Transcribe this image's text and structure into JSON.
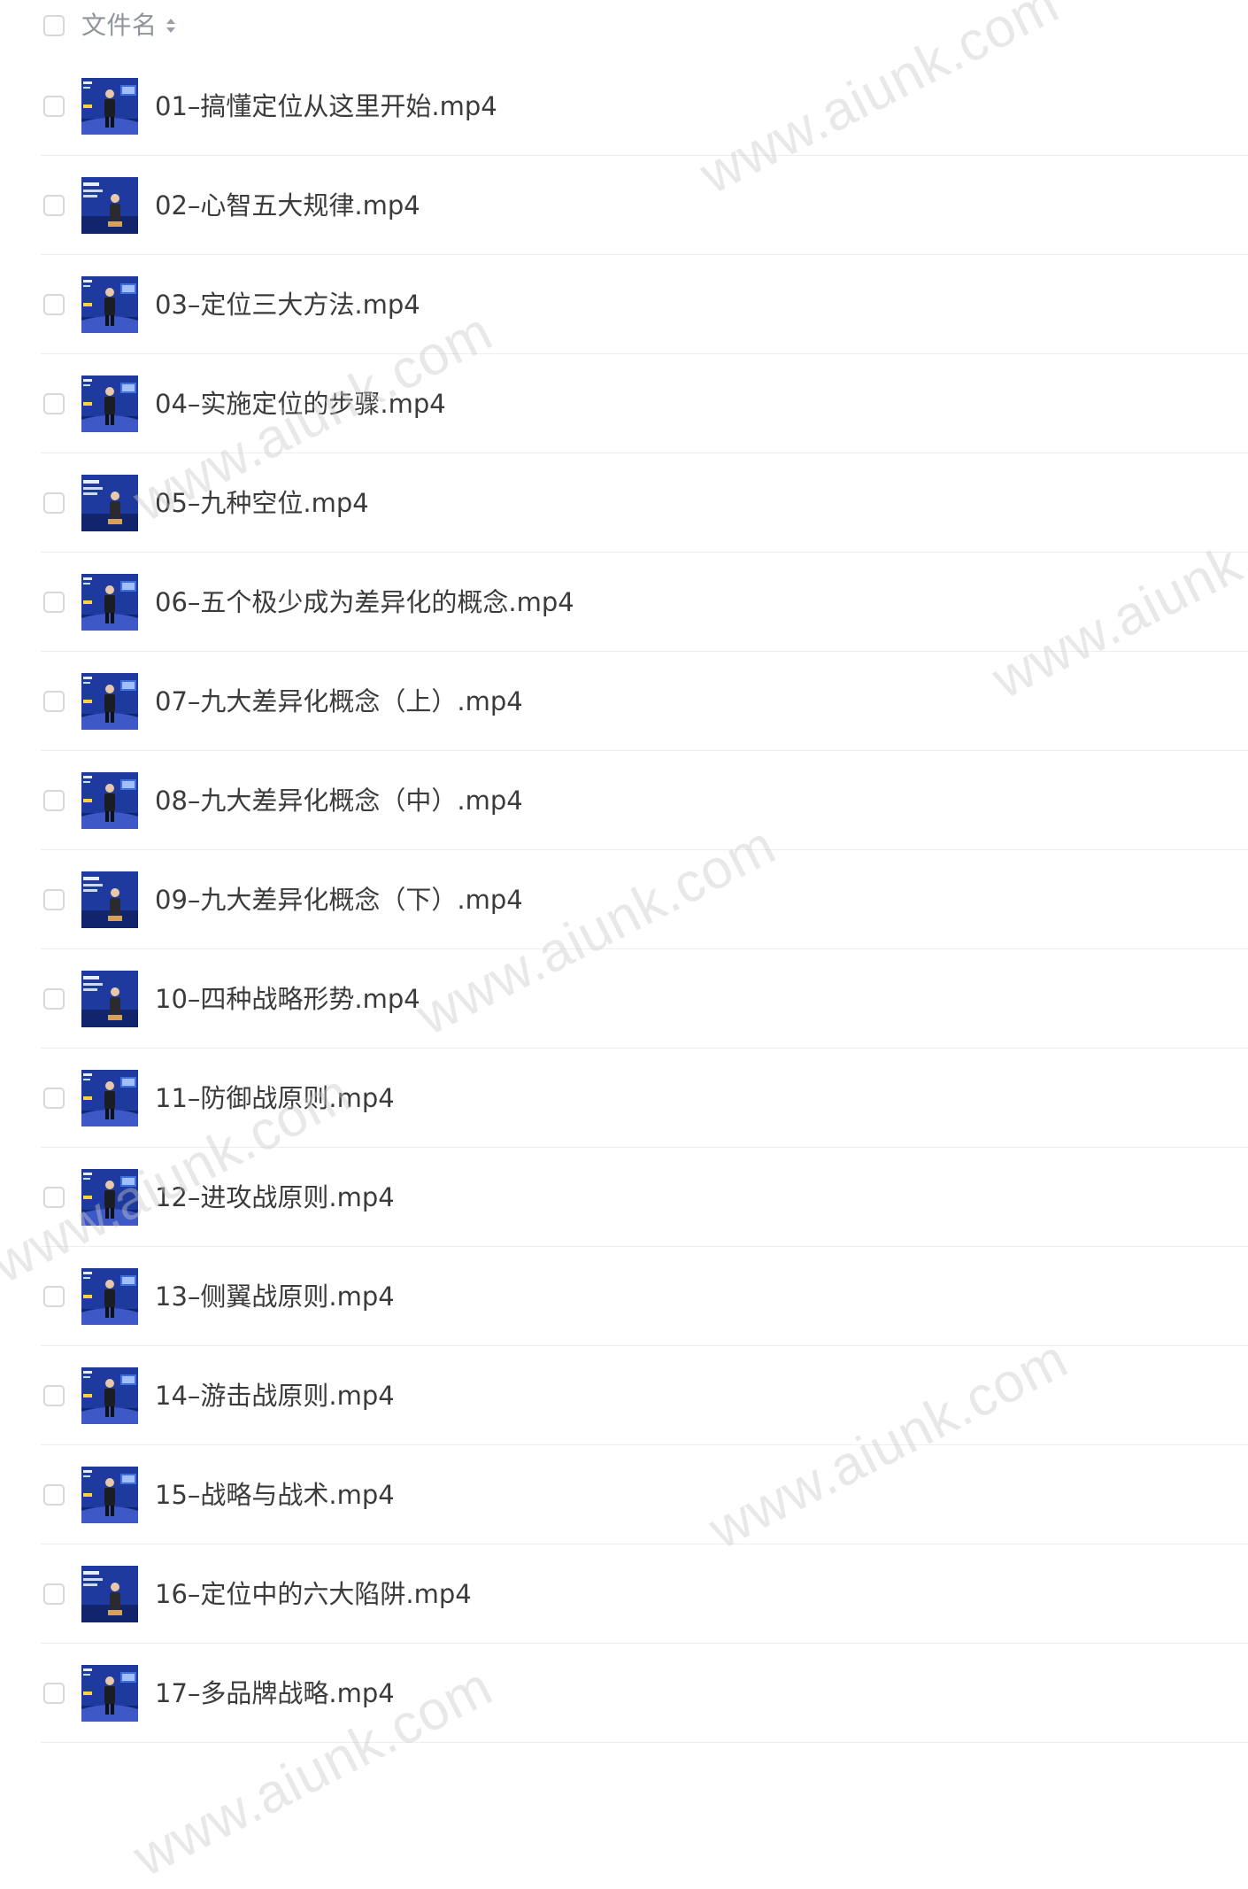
{
  "header": {
    "column_label": "文件名",
    "sort_icon": "sort-updown-icon"
  },
  "files": [
    {
      "name": "01–搞懂定位从这里开始.mp4",
      "thumb": "a"
    },
    {
      "name": "02–心智五大规律.mp4",
      "thumb": "b"
    },
    {
      "name": "03–定位三大方法.mp4",
      "thumb": "a"
    },
    {
      "name": "04–实施定位的步骤.mp4",
      "thumb": "a"
    },
    {
      "name": "05–九种空位.mp4",
      "thumb": "b"
    },
    {
      "name": "06–五个极少成为差异化的概念.mp4",
      "thumb": "a"
    },
    {
      "name": "07–九大差异化概念（上）.mp4",
      "thumb": "a"
    },
    {
      "name": "08–九大差异化概念（中）.mp4",
      "thumb": "a"
    },
    {
      "name": "09–九大差异化概念（下）.mp4",
      "thumb": "b"
    },
    {
      "name": "10–四种战略形势.mp4",
      "thumb": "b"
    },
    {
      "name": "11–防御战原则.mp4",
      "thumb": "a"
    },
    {
      "name": "12–进攻战原则.mp4",
      "thumb": "a"
    },
    {
      "name": "13–侧翼战原则.mp4",
      "thumb": "a"
    },
    {
      "name": "14–游击战原则.mp4",
      "thumb": "a"
    },
    {
      "name": "15–战略与战术.mp4",
      "thumb": "a"
    },
    {
      "name": "16–定位中的六大陷阱.mp4",
      "thumb": "b"
    },
    {
      "name": "17–多品牌战略.mp4",
      "thumb": "a"
    }
  ],
  "watermark": {
    "text": "www.aiunk.com"
  },
  "colors": {
    "thumb_bg": "#1f3a9e",
    "thumb_dark": "#12246b",
    "checkbox_border": "#d4d7de",
    "divider": "#eceef2"
  }
}
